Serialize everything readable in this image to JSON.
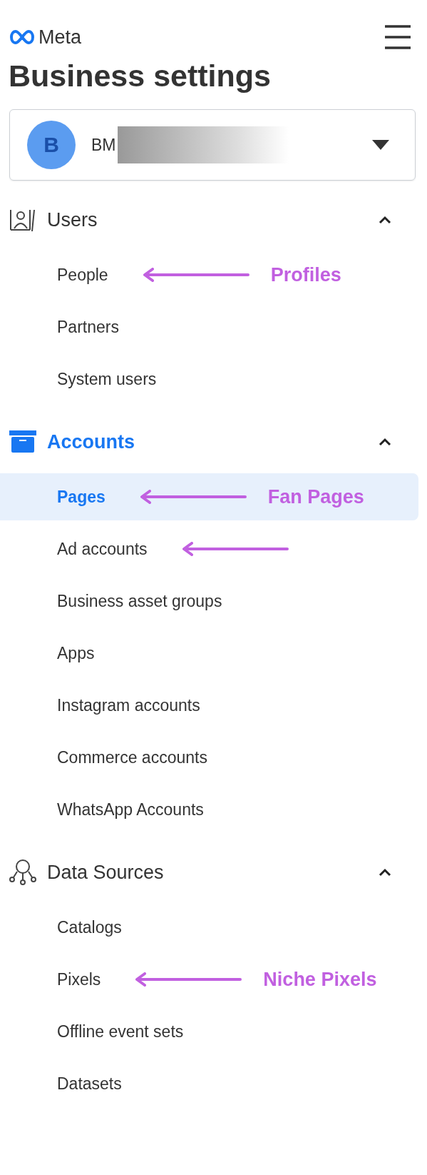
{
  "header": {
    "logo_text": "Meta",
    "title": "Business settings"
  },
  "account": {
    "initial": "B",
    "name": "BM",
    "redacted": true
  },
  "sections": [
    {
      "label": "Users",
      "kind": "users",
      "active": false,
      "expanded": true,
      "items": [
        {
          "label": "People",
          "selected": false,
          "arrow": true,
          "note": "Profiles"
        },
        {
          "label": "Partners",
          "selected": false,
          "arrow": false
        },
        {
          "label": "System users",
          "selected": false,
          "arrow": false
        }
      ]
    },
    {
      "label": "Accounts",
      "kind": "accounts",
      "active": true,
      "expanded": true,
      "items": [
        {
          "label": "Pages",
          "selected": true,
          "arrow": true,
          "note": "Fan Pages"
        },
        {
          "label": "Ad accounts",
          "selected": false,
          "arrow": true
        },
        {
          "label": "Business asset groups",
          "selected": false,
          "arrow": false
        },
        {
          "label": "Apps",
          "selected": false,
          "arrow": false
        },
        {
          "label": "Instagram accounts",
          "selected": false,
          "arrow": false
        },
        {
          "label": "Commerce accounts",
          "selected": false,
          "arrow": false
        },
        {
          "label": "WhatsApp Accounts",
          "selected": false,
          "arrow": false
        }
      ]
    },
    {
      "label": "Data Sources",
      "kind": "data_sources",
      "active": false,
      "expanded": true,
      "items": [
        {
          "label": "Catalogs",
          "selected": false,
          "arrow": false
        },
        {
          "label": "Pixels",
          "selected": false,
          "arrow": true,
          "note": "Niche Pixels"
        },
        {
          "label": "Offline event sets",
          "selected": false,
          "arrow": false
        },
        {
          "label": "Datasets",
          "selected": false,
          "arrow": false
        }
      ]
    }
  ]
}
